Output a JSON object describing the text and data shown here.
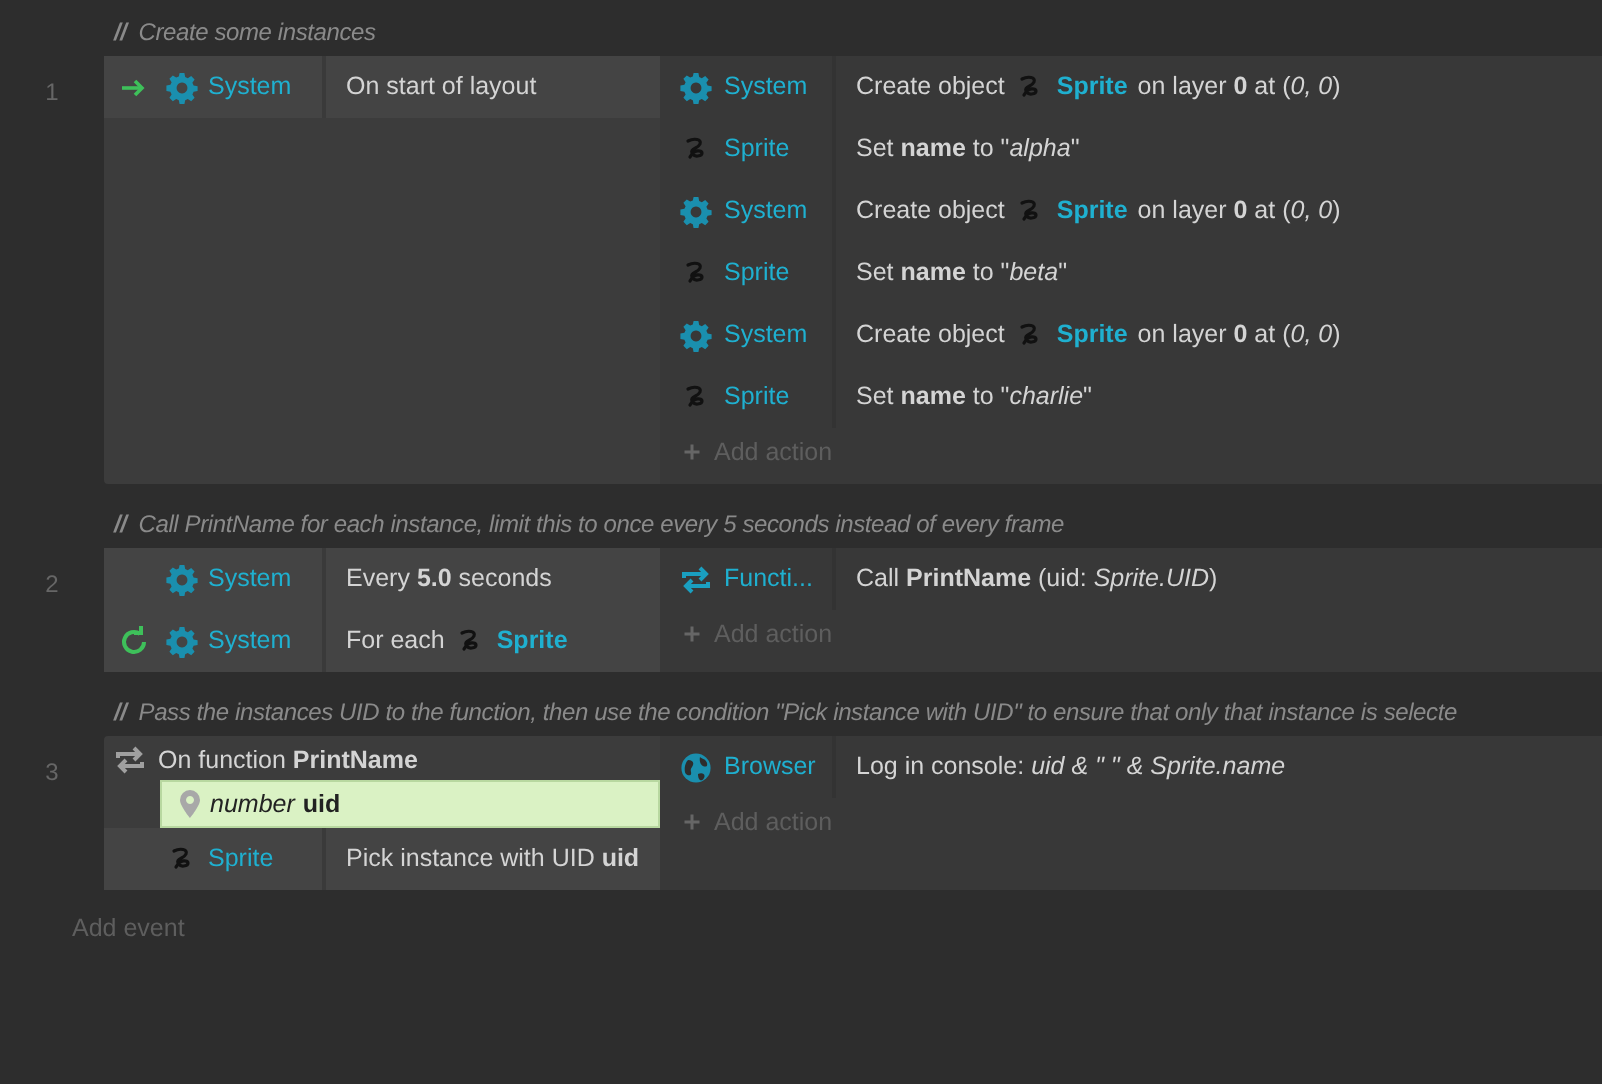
{
  "events": [
    {
      "comment": {
        "mark": "//",
        "text": "Create some instances"
      },
      "number": "1",
      "conditions": [
        {
          "kind": "trigger",
          "object": {
            "kind": "system",
            "name": "System"
          },
          "parts": [
            {
              "kind": "text",
              "text": "On start of layout"
            }
          ]
        }
      ],
      "actions": [
        {
          "object": {
            "kind": "system",
            "name": "System"
          },
          "parts": [
            {
              "kind": "text",
              "text": "Create object"
            },
            {
              "kind": "sprite",
              "text": "Sprite"
            },
            {
              "kind": "text",
              "text": "on layer **0** at (*0, 0*)"
            }
          ]
        },
        {
          "object": {
            "kind": "sprite",
            "name": "Sprite"
          },
          "parts": [
            {
              "kind": "text",
              "text": "Set **name** to \"*alpha*\""
            }
          ]
        },
        {
          "object": {
            "kind": "system",
            "name": "System"
          },
          "parts": [
            {
              "kind": "text",
              "text": "Create object"
            },
            {
              "kind": "sprite",
              "text": "Sprite"
            },
            {
              "kind": "text",
              "text": "on layer **0** at (*0, 0*)"
            }
          ]
        },
        {
          "object": {
            "kind": "sprite",
            "name": "Sprite"
          },
          "parts": [
            {
              "kind": "text",
              "text": "Set **name** to \"*beta*\""
            }
          ]
        },
        {
          "object": {
            "kind": "system",
            "name": "System"
          },
          "parts": [
            {
              "kind": "text",
              "text": "Create object"
            },
            {
              "kind": "sprite",
              "text": "Sprite"
            },
            {
              "kind": "text",
              "text": "on layer **0** at (*0, 0*)"
            }
          ]
        },
        {
          "object": {
            "kind": "sprite",
            "name": "Sprite"
          },
          "parts": [
            {
              "kind": "text",
              "text": "Set **name** to \"*charlie*\""
            }
          ]
        }
      ],
      "add_action": "Add action"
    },
    {
      "comment": {
        "mark": "//",
        "text": "Call PrintName for each instance, limit this to once every 5 seconds instead of every frame"
      },
      "number": "2",
      "conditions": [
        {
          "kind": "plain",
          "object": {
            "kind": "system",
            "name": "System"
          },
          "parts": [
            {
              "kind": "text",
              "text": "Every **5.0** seconds"
            }
          ]
        },
        {
          "kind": "loop",
          "object": {
            "kind": "system",
            "name": "System"
          },
          "parts": [
            {
              "kind": "text",
              "text": "For each"
            },
            {
              "kind": "sprite",
              "text": "Sprite"
            }
          ]
        }
      ],
      "actions": [
        {
          "object": {
            "kind": "function",
            "name": "Functi..."
          },
          "parts": [
            {
              "kind": "text",
              "text": "Call **PrintName** (uid: *Sprite.UID*)"
            }
          ]
        }
      ],
      "add_action": "Add action"
    },
    {
      "comment": {
        "mark": "//",
        "text": "Pass the instances UID to the function, then use the condition \"Pick instance with UID\" to ensure that only that instance is selecte"
      },
      "number": "3",
      "function": {
        "label": "On function **PrintName**",
        "params": [
          {
            "type": "number",
            "name": "uid"
          }
        ]
      },
      "conditions": [
        {
          "kind": "plain",
          "object": {
            "kind": "sprite",
            "name": "Sprite"
          },
          "parts": [
            {
              "kind": "text",
              "text": "Pick instance with UID **uid**"
            }
          ]
        }
      ],
      "actions": [
        {
          "object": {
            "kind": "browser",
            "name": "Browser"
          },
          "parts": [
            {
              "kind": "text",
              "text": "Log in console: *uid & \" \" & Sprite.name*"
            }
          ]
        }
      ],
      "add_action": "Add action"
    }
  ],
  "add_event": "Add event"
}
